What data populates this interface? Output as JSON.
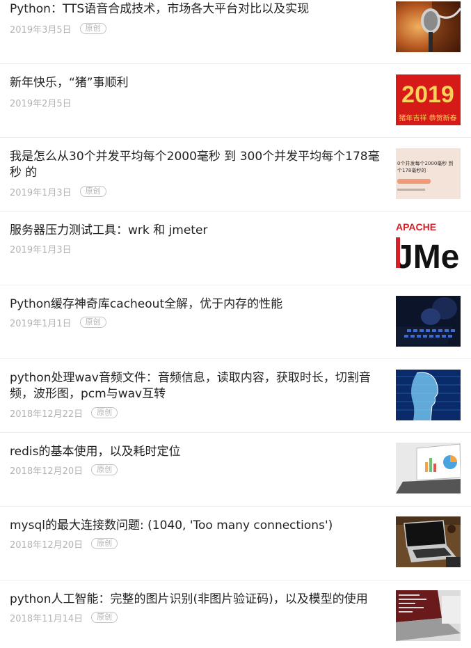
{
  "articles": [
    {
      "title": "Python：TTS语音合成技术，市场各大平台对比以及实现",
      "date": "2019年3月5日",
      "badge": "原创",
      "thumbnail": "microphone-image"
    },
    {
      "title": "新年快乐，“猪”事顺利",
      "date": "2019年2月5日",
      "badge": "",
      "thumbnail": "new-year-2019-banner",
      "thumb_text": "2019",
      "thumb_subtext": "猪年吉祥 恭贺新春"
    },
    {
      "title": "我是怎么从30个并发平均每个2000毫秒 到 300个并发平均每个178毫秒 的",
      "date": "2019年1月3日",
      "badge": "原创",
      "thumbnail": "performance-slide-image",
      "thumb_text": "0个并发每个2000毫秒 到",
      "thumb_subtext": "个178毫秒的"
    },
    {
      "title": "服务器压力测试工具：wrk 和 jmeter",
      "date": "2019年1月3日",
      "badge": "",
      "thumbnail": "apache-jmeter-logo",
      "thumb_text": "APACHE",
      "thumb_subtext": "JMe"
    },
    {
      "title": "Python缓存神奇库cacheout全解，优于内存的性能",
      "date": "2019年1月1日",
      "badge": "原创",
      "thumbnail": "hacker-keyboard-image"
    },
    {
      "title": "python处理wav音频文件：音频信息，读取内容，获取时长，切割音频，波形图，pcm与wav互转",
      "date": "2018年12月22日",
      "badge": "原创",
      "thumbnail": "ai-face-image"
    },
    {
      "title": "redis的基本使用，以及耗时定位",
      "date": "2018年12月20日",
      "badge": "原创",
      "thumbnail": "laptop-charts-image"
    },
    {
      "title": "mysql的最大连接数问题: (1040, 'Too many connections')",
      "date": "2018年12月20日",
      "badge": "原创",
      "thumbnail": "laptop-desk-image"
    },
    {
      "title": "python人工智能：完整的图片识别(非图片验证码)，以及模型的使用",
      "date": "2018年11月14日",
      "badge": "原创",
      "thumbnail": "laptop-code-image"
    }
  ]
}
